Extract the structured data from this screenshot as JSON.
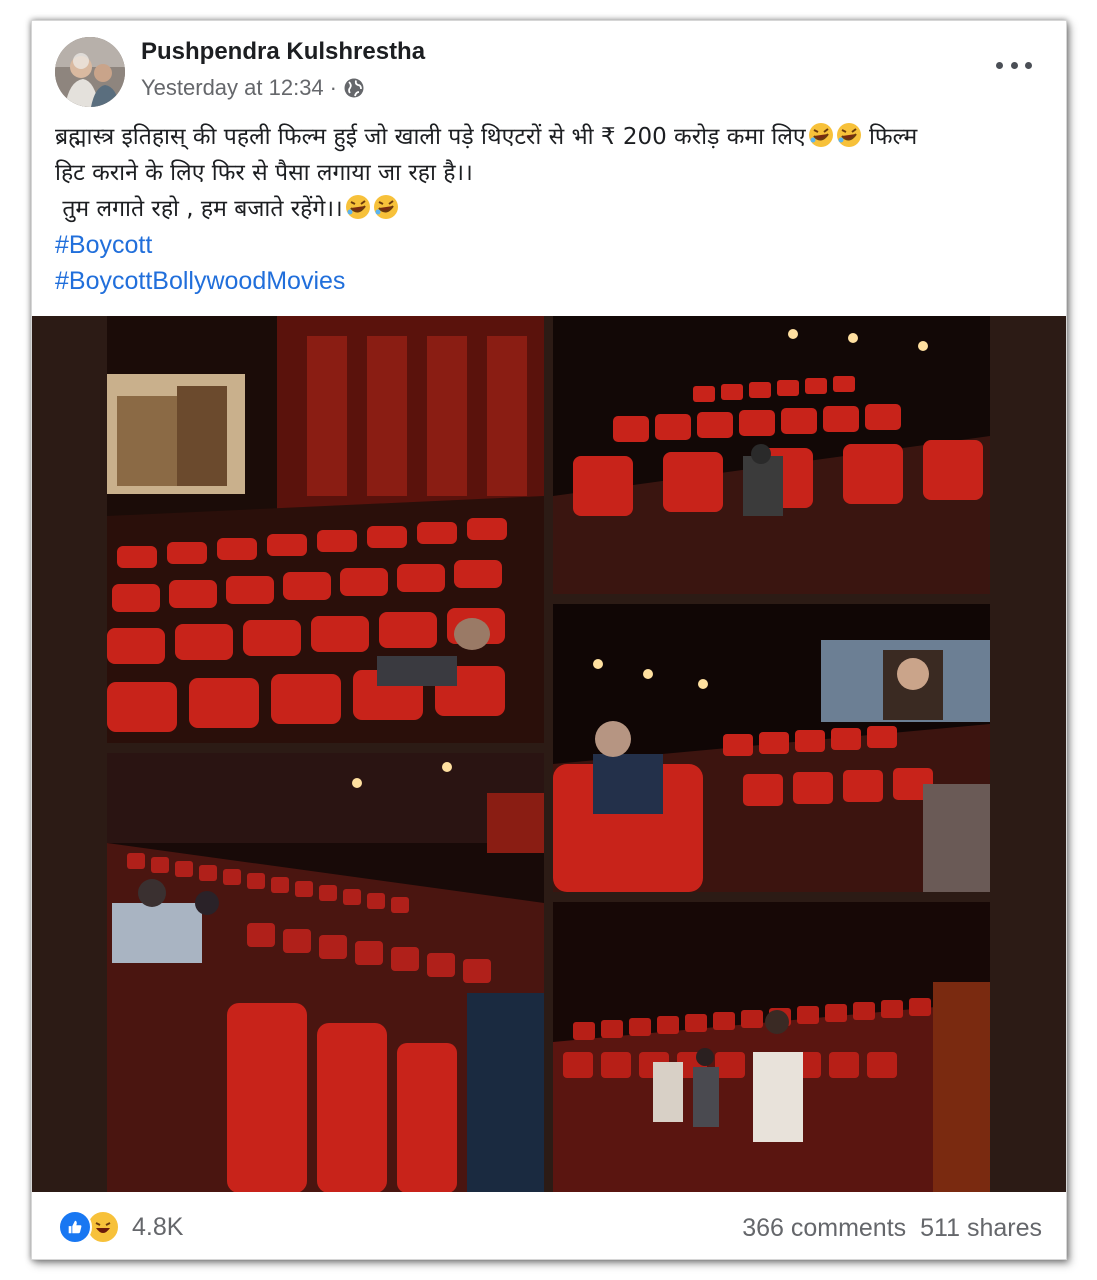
{
  "post": {
    "author": "Pushpendra Kulshrestha",
    "timestamp": "Yesterday at 12:34",
    "separator": "·",
    "privacy_icon": "globe-icon",
    "text_lines": [
      "ब्रह्मास्त्र इतिहास् की पहली फिल्म हुई जो खाली पड़े थिएटरों से भी ₹ 200 करोड़ कमा लिए",
      "फिल्म",
      "हिट कराने के लिए फिर से पैसा लगाया जा रहा है।।",
      " तुम लगाते रहो , हम बजाते रहेंगे।।"
    ],
    "hashtags": [
      "#Boycott",
      "#BoycottBollywoodMovies"
    ]
  },
  "photos": [
    {
      "name": "empty-theater-photo-1",
      "description_icon": "theater-icon"
    },
    {
      "name": "empty-theater-photo-2",
      "description_icon": "theater-icon"
    },
    {
      "name": "empty-theater-photo-3",
      "description_icon": "theater-icon"
    },
    {
      "name": "empty-theater-photo-4",
      "description_icon": "theater-icon"
    },
    {
      "name": "empty-theater-photo-5",
      "description_icon": "theater-icon"
    }
  ],
  "footer": {
    "reaction_icons": [
      "like-icon",
      "haha-icon"
    ],
    "reaction_count": "4.8K",
    "comments": "366 comments",
    "shares": "511 shares"
  },
  "colors": {
    "link": "#216fdb",
    "muted": "#65676b",
    "like": "#1877f2",
    "haha": "#f7c13a",
    "seat_red": "#c8231a",
    "frame_bg": "#2c1b15"
  }
}
